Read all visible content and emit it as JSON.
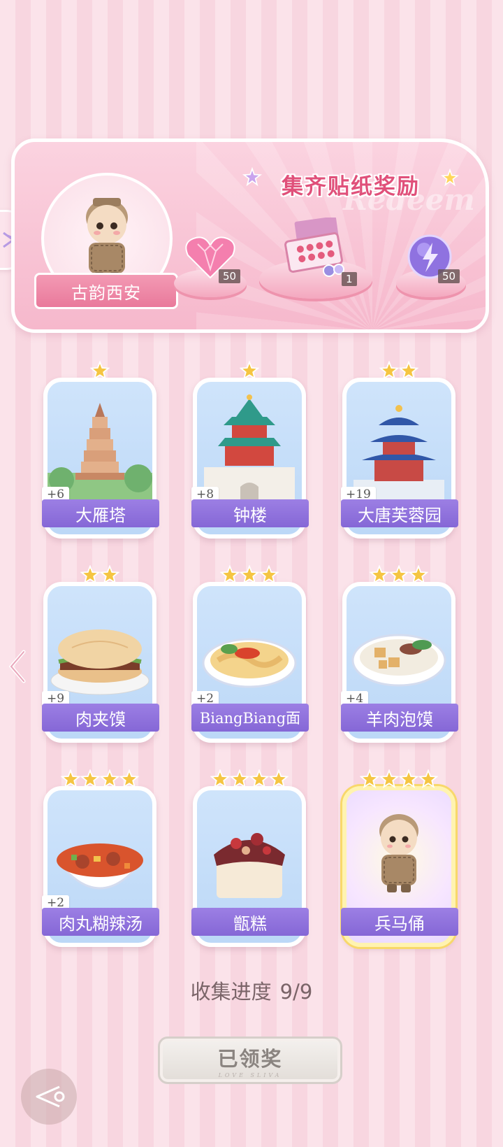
{
  "banner": {
    "title": "集齐贴纸奖励",
    "watermark": "Redeem",
    "set_name": "古韵西安",
    "rewards": [
      {
        "icon": "pink-heart-gem-icon",
        "quantity": "50"
      },
      {
        "icon": "gift-box-icon",
        "quantity": "1"
      },
      {
        "icon": "purple-lightning-orb-icon",
        "quantity": "50"
      }
    ]
  },
  "stickers": [
    {
      "name": "大雁塔",
      "bonus": "+6",
      "stars": 1,
      "art": "pagoda"
    },
    {
      "name": "钟楼",
      "bonus": "+8",
      "stars": 1,
      "art": "bell-tower"
    },
    {
      "name": "大唐芙蓉园",
      "bonus": "+19",
      "stars": 2,
      "art": "temple"
    },
    {
      "name": "肉夹馍",
      "bonus": "+9",
      "stars": 2,
      "art": "roujiamo"
    },
    {
      "name": "BiangBiang面",
      "bonus": "+2",
      "stars": 3,
      "art": "noodles"
    },
    {
      "name": "羊肉泡馍",
      "bonus": "+4",
      "stars": 3,
      "art": "paomo"
    },
    {
      "name": "肉丸糊辣汤",
      "bonus": "+2",
      "stars": 4,
      "art": "soup"
    },
    {
      "name": "甑糕",
      "bonus": "",
      "stars": 4,
      "art": "cake"
    },
    {
      "name": "兵马俑",
      "bonus": "",
      "stars": 4,
      "art": "warrior"
    }
  ],
  "progress": {
    "label": "收集进度",
    "value": "9/9"
  },
  "claim_button": {
    "label": "已领奖",
    "sub": "LOVE SLIVA"
  },
  "colors": {
    "accent_pink": "#e0507a",
    "label_purple": "#8567d6",
    "star_gold": "#f5c542"
  }
}
